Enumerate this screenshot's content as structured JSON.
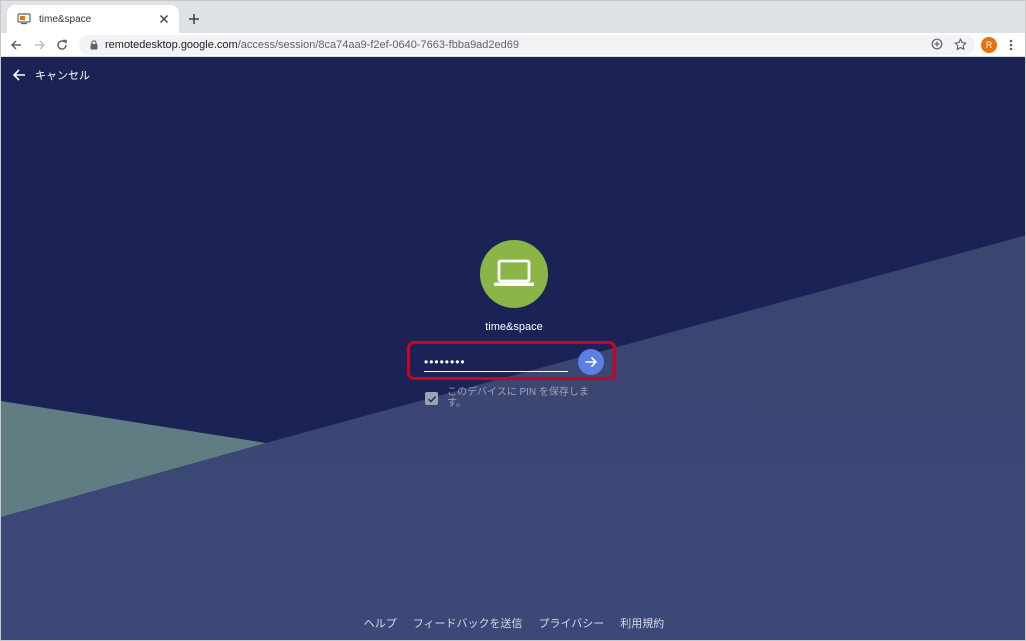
{
  "browser": {
    "tab": {
      "title": "time&space",
      "favicon": "remote-desktop-icon"
    },
    "url": {
      "host": "remotedesktop.google.com",
      "path": "/access/session/8ca74aa9-f2ef-0640-7663-fbba9ad2ed69"
    },
    "profile_initial": "R",
    "profile_color": "#e8710a"
  },
  "page": {
    "cancel_label": "キャンセル",
    "host_name": "time&space",
    "host_icon": "laptop-icon",
    "host_icon_color": "#8bb547",
    "pin_value": "••••••••",
    "remember_label": "このデバイスに PIN を保存します。",
    "remember_checked": true,
    "highlight_color": "#d0021b",
    "submit_button_color": "#5c7fe1",
    "background_color": "#1b2356",
    "footer": {
      "help": "ヘルプ",
      "feedback": "フィードバックを送信",
      "privacy": "プライバシー",
      "terms": "利用規約"
    }
  }
}
